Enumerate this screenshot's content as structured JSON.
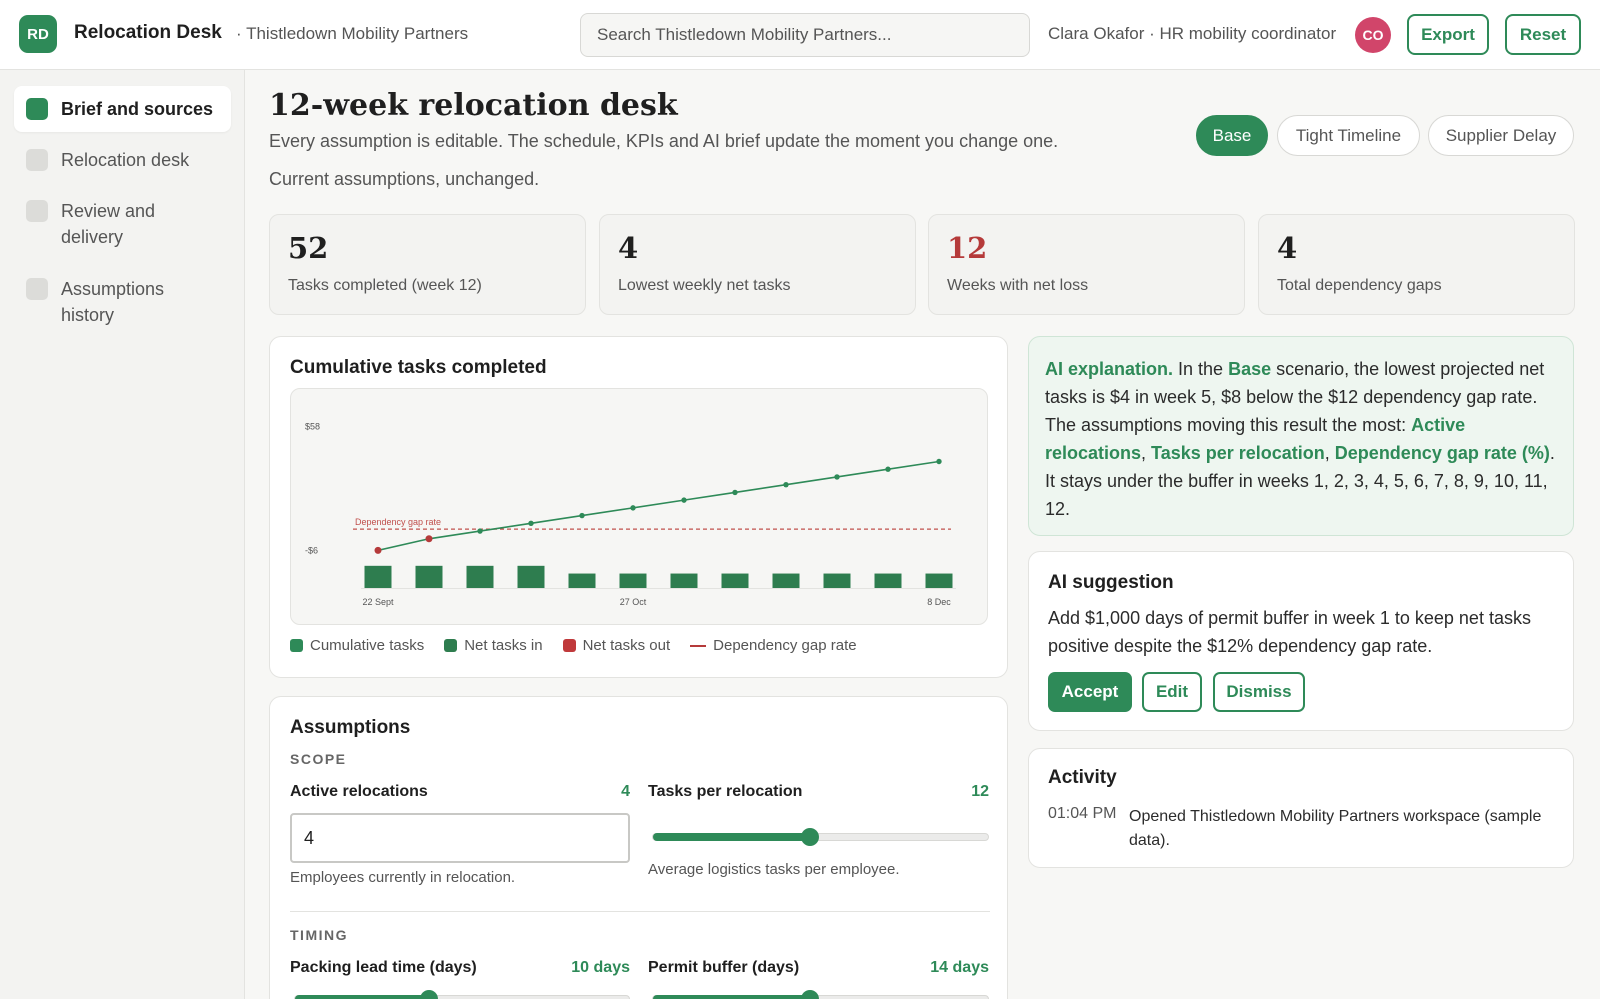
{
  "app": {
    "logo_initials": "RD",
    "title": "Relocation Desk",
    "org": "· Thistledown Mobility Partners",
    "search_placeholder": "Search Thistledown Mobility Partners...",
    "user": "Clara Okafor · HR mobility coordinator",
    "user_initials": "CO",
    "export_label": "Export",
    "reset_label": "Reset"
  },
  "sidebar": {
    "items": [
      {
        "label": "Brief and sources",
        "active": true
      },
      {
        "label": "Relocation desk",
        "active": false
      },
      {
        "label": "Review and delivery",
        "active": false
      },
      {
        "label": "Assumptions history",
        "active": false
      }
    ]
  },
  "page": {
    "title": "12-week relocation desk",
    "subtitle": "Every assumption is editable. The schedule, KPIs and AI brief update the moment you change one.",
    "note": "Current assumptions, unchanged.",
    "scenarios": [
      "Base",
      "Tight Timeline",
      "Supplier Delay"
    ],
    "active_scenario": "Base"
  },
  "kpis": [
    {
      "value": "52",
      "label": "Tasks completed (week 12)",
      "alert": false
    },
    {
      "value": "4",
      "label": "Lowest weekly net tasks",
      "alert": false
    },
    {
      "value": "12",
      "label": "Weeks with net loss",
      "alert": true
    },
    {
      "value": "4",
      "label": "Total dependency gaps",
      "alert": false
    }
  ],
  "chart_panel": {
    "title": "Cumulative tasks completed",
    "legend": [
      "Cumulative tasks",
      "Net tasks in",
      "Net tasks out",
      "Dependency gap rate"
    ]
  },
  "chart_data": {
    "type": "line",
    "title": "Cumulative tasks completed",
    "y_tick_labels": [
      "$58",
      "-$6"
    ],
    "y_ticks": [
      58,
      -6
    ],
    "x_tick_labels": [
      "22 Sept",
      "27 Oct",
      "8 Dec"
    ],
    "x_tick_weeks": [
      1,
      6,
      12
    ],
    "ylim": [
      -26,
      62
    ],
    "weeks": [
      1,
      2,
      3,
      4,
      5,
      6,
      7,
      8,
      9,
      10,
      11,
      12
    ],
    "series": [
      {
        "name": "Cumulative tasks",
        "kind": "line",
        "values": [
          -6,
          0,
          4,
          8,
          12,
          16,
          20,
          24,
          28,
          32,
          36,
          40
        ]
      },
      {
        "name": "Net tasks in",
        "kind": "bar",
        "values": [
          -14,
          -14,
          -14,
          -14,
          -18,
          -18,
          -18,
          -18,
          -18,
          -18,
          -18,
          -18
        ]
      }
    ],
    "negative_weeks": [
      1,
      2
    ],
    "dependency_gap_rate": {
      "label": "Dependency gap rate",
      "value": 5
    },
    "colors": {
      "line": "#2e8a58",
      "bar": "#2e7d4f",
      "negative": "#b53a3a",
      "gap": "#c0504d"
    },
    "grid": false
  },
  "assumptions": {
    "title": "Assumptions",
    "scope_label": "SCOPE",
    "timing_label": "TIMING",
    "active_relocations": {
      "label": "Active relocations",
      "value": "4",
      "help": "Employees currently in relocation."
    },
    "tasks_per_relocation": {
      "label": "Tasks per relocation",
      "value": "12",
      "help": "Average logistics tasks per employee.",
      "fraction": 0.47
    },
    "packing_lead_time": {
      "label": "Packing lead time (days)",
      "value": "10 days",
      "fraction": 0.4
    },
    "permit_buffer": {
      "label": "Permit buffer (days)",
      "value": "14 days",
      "fraction": 0.47
    }
  },
  "ai_explanation": {
    "lead": "AI explanation.",
    "t1": " In the ",
    "scenario": "Base",
    "t2": " scenario, the lowest projected net tasks is $4 in week 5, $8 below the $12 dependency gap rate. The assumptions moving this result the most: ",
    "f1": "Active relocations",
    "sep1": ", ",
    "f2": "Tasks per relocation",
    "sep2": ", ",
    "f3": "Dependency gap rate (%)",
    "t3": ". It stays under the buffer in weeks 1, 2, 3, 4, 5, 6, 7, 8, 9, 10, 11, 12."
  },
  "ai_suggestion": {
    "title": "AI suggestion",
    "text": "Add $1,000 days of permit buffer in week 1 to keep net tasks positive despite the $12% dependency gap rate.",
    "accept": "Accept",
    "edit": "Edit",
    "dismiss": "Dismiss"
  },
  "activity": {
    "title": "Activity",
    "entries": [
      {
        "time": "01:04 PM",
        "text": "Opened Thistledown Mobility Partners workspace (sample data)."
      }
    ]
  }
}
